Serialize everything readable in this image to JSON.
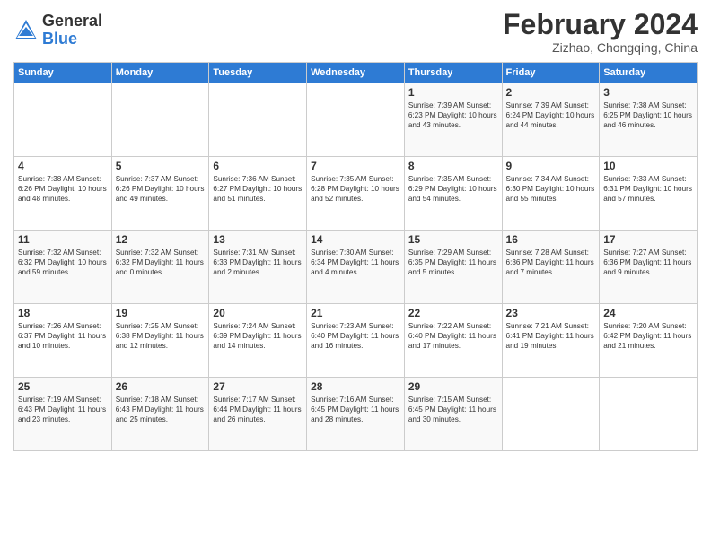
{
  "header": {
    "logo_general": "General",
    "logo_blue": "Blue",
    "month_title": "February 2024",
    "subtitle": "Zizhao, Chongqing, China"
  },
  "days_of_week": [
    "Sunday",
    "Monday",
    "Tuesday",
    "Wednesday",
    "Thursday",
    "Friday",
    "Saturday"
  ],
  "weeks": [
    [
      {
        "day": "",
        "info": ""
      },
      {
        "day": "",
        "info": ""
      },
      {
        "day": "",
        "info": ""
      },
      {
        "day": "",
        "info": ""
      },
      {
        "day": "1",
        "info": "Sunrise: 7:39 AM\nSunset: 6:23 PM\nDaylight: 10 hours\nand 43 minutes."
      },
      {
        "day": "2",
        "info": "Sunrise: 7:39 AM\nSunset: 6:24 PM\nDaylight: 10 hours\nand 44 minutes."
      },
      {
        "day": "3",
        "info": "Sunrise: 7:38 AM\nSunset: 6:25 PM\nDaylight: 10 hours\nand 46 minutes."
      }
    ],
    [
      {
        "day": "4",
        "info": "Sunrise: 7:38 AM\nSunset: 6:26 PM\nDaylight: 10 hours\nand 48 minutes."
      },
      {
        "day": "5",
        "info": "Sunrise: 7:37 AM\nSunset: 6:26 PM\nDaylight: 10 hours\nand 49 minutes."
      },
      {
        "day": "6",
        "info": "Sunrise: 7:36 AM\nSunset: 6:27 PM\nDaylight: 10 hours\nand 51 minutes."
      },
      {
        "day": "7",
        "info": "Sunrise: 7:35 AM\nSunset: 6:28 PM\nDaylight: 10 hours\nand 52 minutes."
      },
      {
        "day": "8",
        "info": "Sunrise: 7:35 AM\nSunset: 6:29 PM\nDaylight: 10 hours\nand 54 minutes."
      },
      {
        "day": "9",
        "info": "Sunrise: 7:34 AM\nSunset: 6:30 PM\nDaylight: 10 hours\nand 55 minutes."
      },
      {
        "day": "10",
        "info": "Sunrise: 7:33 AM\nSunset: 6:31 PM\nDaylight: 10 hours\nand 57 minutes."
      }
    ],
    [
      {
        "day": "11",
        "info": "Sunrise: 7:32 AM\nSunset: 6:32 PM\nDaylight: 10 hours\nand 59 minutes."
      },
      {
        "day": "12",
        "info": "Sunrise: 7:32 AM\nSunset: 6:32 PM\nDaylight: 11 hours\nand 0 minutes."
      },
      {
        "day": "13",
        "info": "Sunrise: 7:31 AM\nSunset: 6:33 PM\nDaylight: 11 hours\nand 2 minutes."
      },
      {
        "day": "14",
        "info": "Sunrise: 7:30 AM\nSunset: 6:34 PM\nDaylight: 11 hours\nand 4 minutes."
      },
      {
        "day": "15",
        "info": "Sunrise: 7:29 AM\nSunset: 6:35 PM\nDaylight: 11 hours\nand 5 minutes."
      },
      {
        "day": "16",
        "info": "Sunrise: 7:28 AM\nSunset: 6:36 PM\nDaylight: 11 hours\nand 7 minutes."
      },
      {
        "day": "17",
        "info": "Sunrise: 7:27 AM\nSunset: 6:36 PM\nDaylight: 11 hours\nand 9 minutes."
      }
    ],
    [
      {
        "day": "18",
        "info": "Sunrise: 7:26 AM\nSunset: 6:37 PM\nDaylight: 11 hours\nand 10 minutes."
      },
      {
        "day": "19",
        "info": "Sunrise: 7:25 AM\nSunset: 6:38 PM\nDaylight: 11 hours\nand 12 minutes."
      },
      {
        "day": "20",
        "info": "Sunrise: 7:24 AM\nSunset: 6:39 PM\nDaylight: 11 hours\nand 14 minutes."
      },
      {
        "day": "21",
        "info": "Sunrise: 7:23 AM\nSunset: 6:40 PM\nDaylight: 11 hours\nand 16 minutes."
      },
      {
        "day": "22",
        "info": "Sunrise: 7:22 AM\nSunset: 6:40 PM\nDaylight: 11 hours\nand 17 minutes."
      },
      {
        "day": "23",
        "info": "Sunrise: 7:21 AM\nSunset: 6:41 PM\nDaylight: 11 hours\nand 19 minutes."
      },
      {
        "day": "24",
        "info": "Sunrise: 7:20 AM\nSunset: 6:42 PM\nDaylight: 11 hours\nand 21 minutes."
      }
    ],
    [
      {
        "day": "25",
        "info": "Sunrise: 7:19 AM\nSunset: 6:43 PM\nDaylight: 11 hours\nand 23 minutes."
      },
      {
        "day": "26",
        "info": "Sunrise: 7:18 AM\nSunset: 6:43 PM\nDaylight: 11 hours\nand 25 minutes."
      },
      {
        "day": "27",
        "info": "Sunrise: 7:17 AM\nSunset: 6:44 PM\nDaylight: 11 hours\nand 26 minutes."
      },
      {
        "day": "28",
        "info": "Sunrise: 7:16 AM\nSunset: 6:45 PM\nDaylight: 11 hours\nand 28 minutes."
      },
      {
        "day": "29",
        "info": "Sunrise: 7:15 AM\nSunset: 6:45 PM\nDaylight: 11 hours\nand 30 minutes."
      },
      {
        "day": "",
        "info": ""
      },
      {
        "day": "",
        "info": ""
      }
    ]
  ]
}
